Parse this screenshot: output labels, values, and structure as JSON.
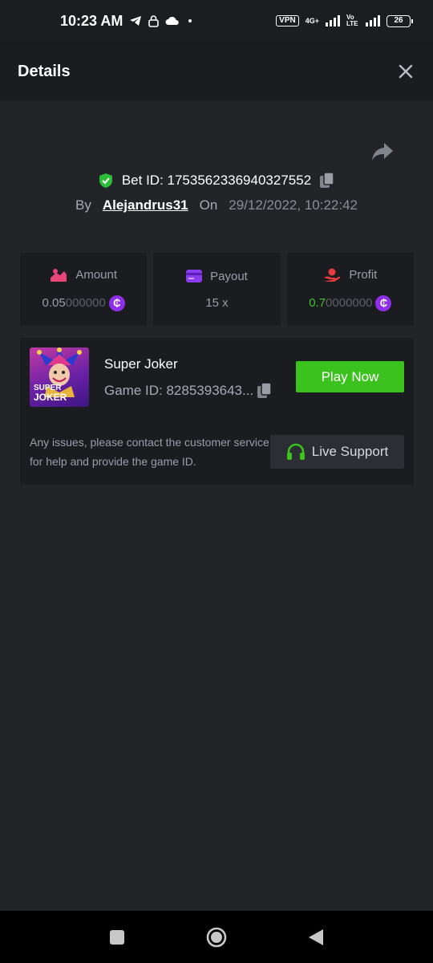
{
  "status_bar": {
    "time": "10:23 AM",
    "vpn": "VPN",
    "network": "4G+",
    "volte": "Vo LTE",
    "battery": "26"
  },
  "header": {
    "title": "Details"
  },
  "bet": {
    "label": "Bet ID: 1753562336940327552",
    "by_label": "By",
    "user": "Alejandrus31",
    "on_label": "On",
    "date": "29/12/2022, 10:22:42"
  },
  "stats": {
    "amount": {
      "label": "Amount",
      "value_main": "0.05",
      "value_dim": "000000",
      "icon": "hand-coins-icon",
      "color": "#e8457a"
    },
    "payout": {
      "label": "Payout",
      "value": "15 x",
      "icon": "wallet-card-icon",
      "color": "#8b3cf0"
    },
    "profit": {
      "label": "Profit",
      "value_main": "0.7",
      "value_dim": "0000000",
      "icon": "hand-profit-icon",
      "color": "#e83c3c"
    }
  },
  "coin_symbol": "₵",
  "game": {
    "thumb_text_1": "SUPER",
    "thumb_text_2": "JOKER",
    "name": "Super Joker",
    "id_label": "Game ID: 8285393643...",
    "play_label": "Play Now"
  },
  "help": {
    "text": "Any issues, please contact the customer service for help and provide the game ID.",
    "support_label": "Live Support"
  },
  "colors": {
    "accent_green": "#3cc21f",
    "background": "#232428",
    "card": "#1b1c20"
  }
}
